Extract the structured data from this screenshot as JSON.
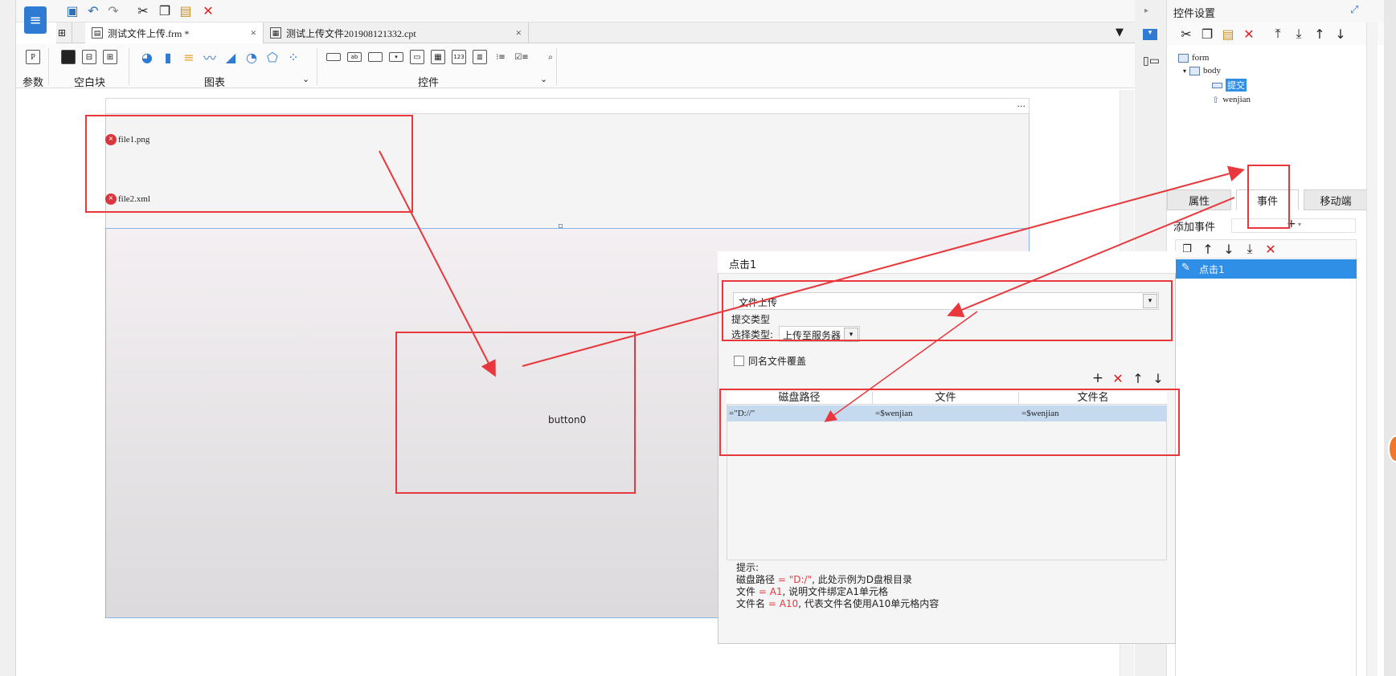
{
  "toolbar": {
    "tabs": [
      {
        "label": "测试文件上传.frm *",
        "close": "×"
      },
      {
        "label": "测试上传文件201908121332.cpt",
        "close": "×"
      }
    ]
  },
  "ribbon": {
    "param_label": "参数",
    "blank_label": "空白块",
    "chart_label": "图表",
    "widget_label": "控件",
    "param_icon": "P"
  },
  "canvas": {
    "file1": "file1.png",
    "file2": "file2.xml",
    "button_label": "button0",
    "dots": "..."
  },
  "panel": {
    "title": "控件设置",
    "tree": {
      "form": "form",
      "body": "body",
      "submit": "提交",
      "wenjian": "wenjian"
    },
    "tabs": [
      "属性",
      "事件",
      "移动端"
    ],
    "active_tab": "事件",
    "add_event_label": "添加事件",
    "event_item": "点击1"
  },
  "dialog": {
    "title": "点击1",
    "type_value": "文件上传",
    "submit_type_label": "提交类型",
    "select_type_label": "选择类型:",
    "select_type_value": "上传至服务器",
    "overwrite_label": "同名文件覆盖",
    "grid": {
      "headers": [
        "磁盘路径",
        "文件",
        "文件名"
      ],
      "rows": [
        [
          "=\"D://\"",
          "=$wenjian",
          "=$wenjian"
        ]
      ]
    },
    "hint_title": "提示:",
    "hint_lines": [
      {
        "prefix": "磁盘路径",
        "eq": " = \"D:/\"",
        "rest": ", 此处示例为D盘根目录"
      },
      {
        "prefix": "文件",
        "eq": " = A1",
        "rest": ", 说明文件绑定A1单元格"
      },
      {
        "prefix": "文件名",
        "eq": " = A10",
        "rest": ", 代表文件名使用A10单元格内容"
      }
    ]
  },
  "colors": {
    "annotation_red": "#e8383d",
    "selection_blue": "#2f8fe6",
    "grid_row_blue": "#c5d9ef"
  }
}
